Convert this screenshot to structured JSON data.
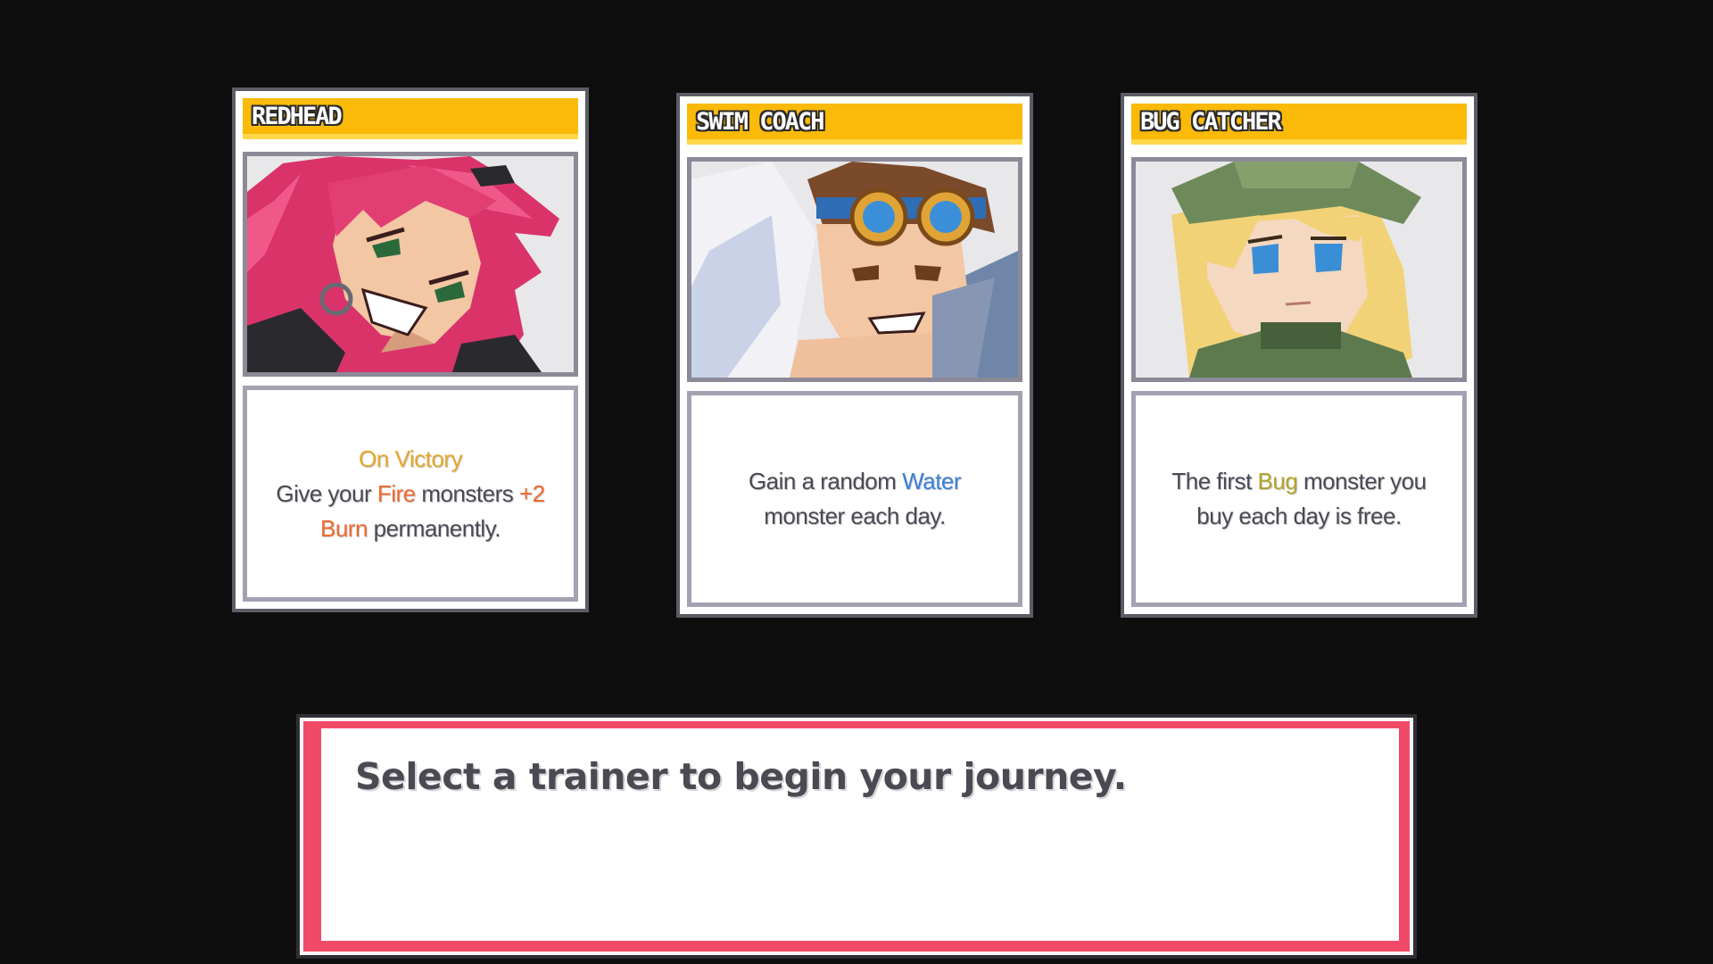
{
  "trainers": [
    {
      "name": "REDHEAD",
      "desc": {
        "line1": "On Victory",
        "pre": "Give your ",
        "type": "Fire",
        "mid": " monsters ",
        "bonus": "+2 Burn",
        "post": " permanently."
      }
    },
    {
      "name": "SWIM COACH",
      "desc": {
        "pre": "Gain a random ",
        "type": "Water",
        "post": " monster each day."
      }
    },
    {
      "name": "BUG CATCHER",
      "desc": {
        "pre": "The first ",
        "type": "Bug",
        "post": " monster you buy each day is free."
      }
    }
  ],
  "dialog": {
    "text": "Select a trainer to begin your journey."
  },
  "colors": {
    "background": "#0e0e0e",
    "header": "#fbb908",
    "dialog_border": "#f04a68",
    "text": "#4a4a52",
    "fire": "#ee6a2c",
    "water": "#3c7fd4",
    "bug": "#b3a52c",
    "trigger": "#e6a82c"
  }
}
